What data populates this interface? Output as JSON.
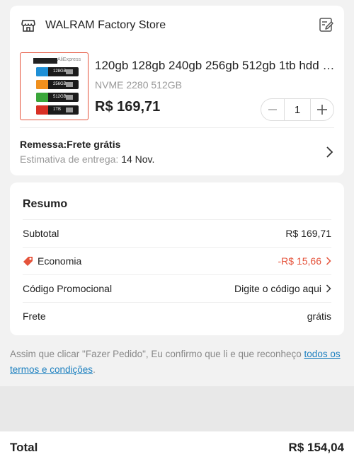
{
  "store": {
    "name": "WALRAM Factory Store",
    "icon": "storefront-icon",
    "note_icon": "edit-note-icon"
  },
  "product": {
    "title": "120gb 128gb 240gb 256gb 512gb 1tb hdd m...",
    "variant": "NVME 2280 512GB",
    "price": "R$ 169,71",
    "quantity": "1",
    "image_labels": {
      "tag": "AliExpress",
      "ssd1": "128GB",
      "ssd2": "256GB",
      "ssd3": "512GB",
      "ssd4": "1TB"
    }
  },
  "shipping": {
    "title": "Remessa:Frete grátis",
    "estimate_label": "Estimativa de entrega: ",
    "estimate_date": "14 Nov."
  },
  "summary": {
    "title": "Resumo",
    "subtotal_label": "Subtotal",
    "subtotal_value": "R$ 169,71",
    "savings_label": "Economia",
    "savings_value": "-R$ 15,66",
    "promo_label": "Código Promocional",
    "promo_value": "Digite o código aqui",
    "freight_label": "Frete",
    "freight_value": "grátis"
  },
  "terms": {
    "text": "Assim que clicar \"Fazer Pedido\", Eu confirmo que li e que reconheço ",
    "link": "todos os termos e condições",
    "end": "."
  },
  "footer": {
    "total_label": "Total",
    "total_value": "R$ 154,04"
  },
  "colors": {
    "accent_red": "#e5533b",
    "link_blue": "#1b7fbf"
  }
}
